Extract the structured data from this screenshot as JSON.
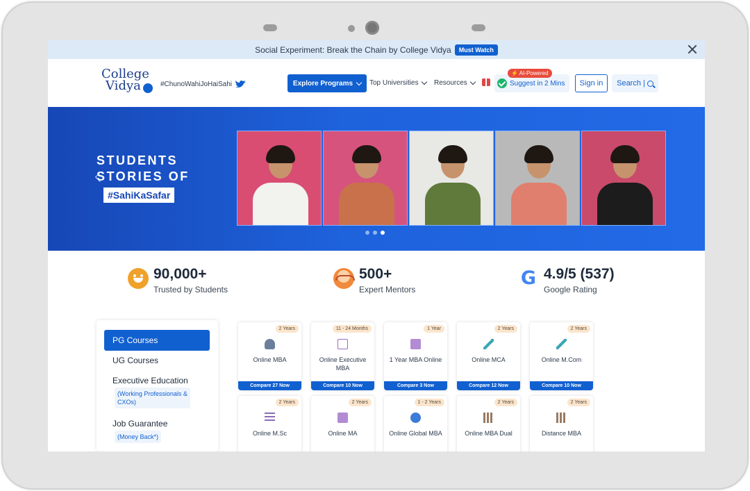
{
  "announcement": {
    "text": "Social Experiment: Break the Chain by College Vidya",
    "button": "Must Watch"
  },
  "header": {
    "logo_line1": "College",
    "logo_line2": "Vidya",
    "hashtag": "#ChunoWahiJoHaiSahi",
    "nav": {
      "explore": "Explore Programs",
      "universities": "Top Universities",
      "resources": "Resources"
    },
    "ai_badge": "⚡ AI-Powered",
    "suggest": "Suggest in 2 Mins",
    "signin": "Sign in",
    "search": "Search |"
  },
  "banner": {
    "title_line1": "STUDENTS",
    "title_line2": "STORIES OF",
    "tag": "#SahiKaSafar",
    "photos": [
      {
        "bg": "#d94d72",
        "shirt": "#f2f2ef"
      },
      {
        "bg": "#d6537e",
        "shirt": "#c9714b"
      },
      {
        "bg": "#e8e8e4",
        "shirt": "#5f7a3a"
      },
      {
        "bg": "#b9b9b9",
        "shirt": "#e07f6d"
      },
      {
        "bg": "#c94a6a",
        "shirt": "#1c1c1c"
      }
    ]
  },
  "stats": [
    {
      "value": "90,000+",
      "label": "Trusted by Students",
      "icon": "smiley-icon"
    },
    {
      "value": "500+",
      "label": "Expert Mentors",
      "icon": "mentor-icon"
    },
    {
      "value": "4.9/5 (537)",
      "label": "Google Rating",
      "icon": "google-icon"
    }
  ],
  "menu": {
    "pg": "PG Courses",
    "ug": "UG Courses",
    "exec": "Executive Education",
    "exec_sub": "(Working Professionals &",
    "exec_sub2": "CXOs)",
    "job": "Job Guarantee",
    "job_sub": "(Money Back*)"
  },
  "courses": [
    {
      "duration": "2 Years",
      "name": "Online MBA",
      "compare": "Compare 27 Now",
      "icon": "person-icon"
    },
    {
      "duration": "11 - 24 Months",
      "name": "Online Executive MBA",
      "compare": "Compare 10 Now",
      "icon": "calendar-icon"
    },
    {
      "duration": "1 Year",
      "name": "1 Year MBA Online",
      "compare": "Compare 3 Now",
      "icon": "book-icon"
    },
    {
      "duration": "2 Years",
      "name": "Online MCA",
      "compare": "Compare 12 Now",
      "icon": "pencil-icon"
    },
    {
      "duration": "2 Years",
      "name": "Online M.Com",
      "compare": "Compare 10 Now",
      "icon": "pencil-icon"
    },
    {
      "duration": "2 Years",
      "name": "Online M.Sc",
      "icon": "list-icon"
    },
    {
      "duration": "2 Years",
      "name": "Online MA",
      "icon": "book-icon"
    },
    {
      "duration": "1 - 2 Years",
      "name": "Online Global MBA",
      "icon": "globe-icon"
    },
    {
      "duration": "2 Years",
      "name": "Online MBA Dual",
      "icon": "books-icon"
    },
    {
      "duration": "2 Years",
      "name": "Distance MBA",
      "icon": "books-icon"
    }
  ]
}
